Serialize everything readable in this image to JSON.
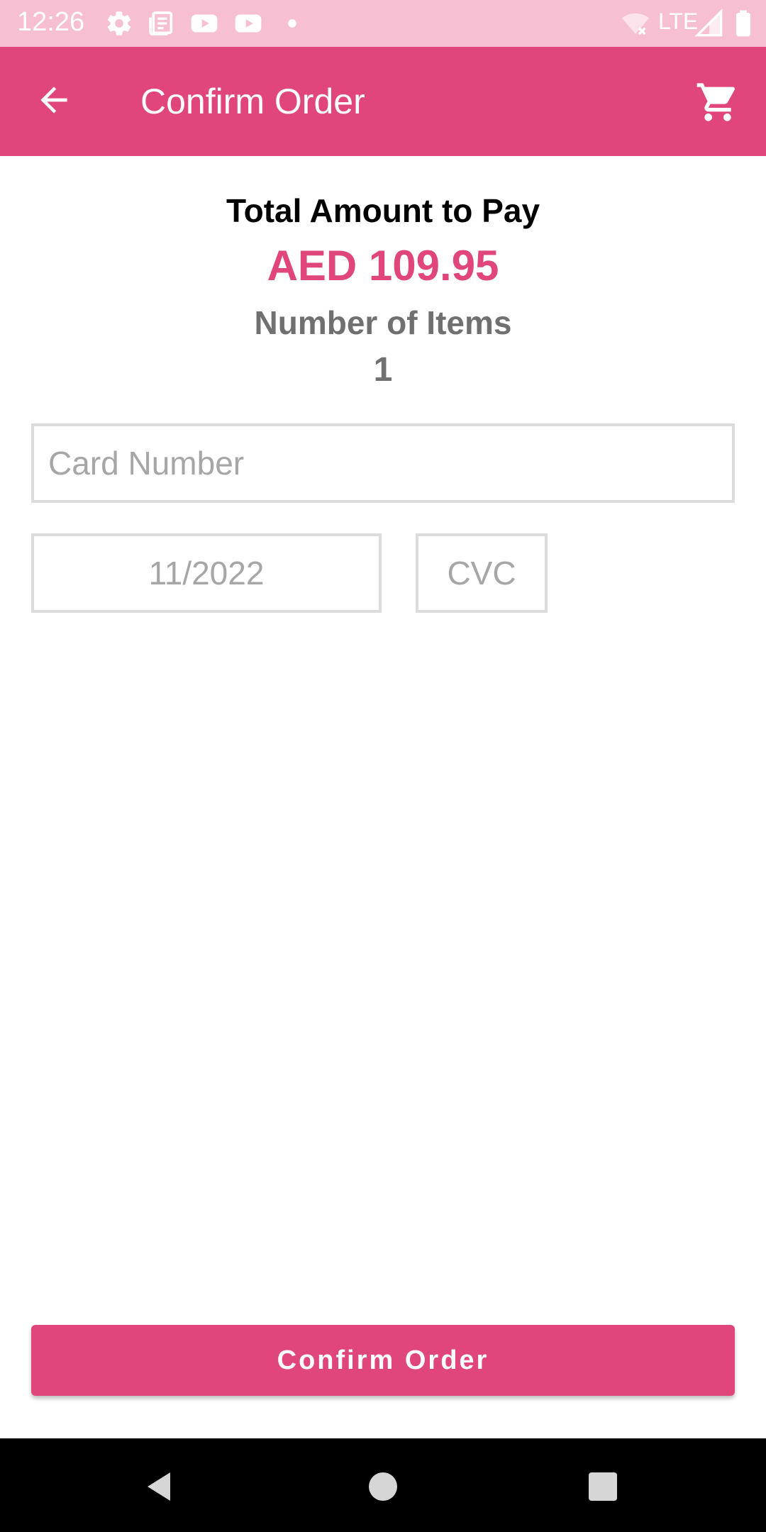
{
  "status_bar": {
    "time": "12:26",
    "icons": [
      "gear-icon",
      "news-icon",
      "youtube-icon",
      "youtube-icon",
      "dot-icon",
      "wifi-off-icon",
      "signal-icon",
      "battery-icon"
    ],
    "network": "LTE"
  },
  "app_bar": {
    "title": "Confirm Order",
    "back_icon": "arrow-back-icon",
    "cart_icon": "cart-icon"
  },
  "summary": {
    "total_label": "Total Amount to Pay",
    "total_amount": "AED 109.95",
    "items_label": "Number of Items",
    "items_count": "1"
  },
  "form": {
    "card_number_placeholder": "Card Number",
    "expiry_placeholder": "11/2022",
    "cvc_placeholder": "CVC"
  },
  "actions": {
    "confirm_label": "Confirm Order"
  },
  "colors": {
    "accent": "#e0457b",
    "status_bar": "#f6bfd2",
    "secondary_text": "#707070"
  }
}
